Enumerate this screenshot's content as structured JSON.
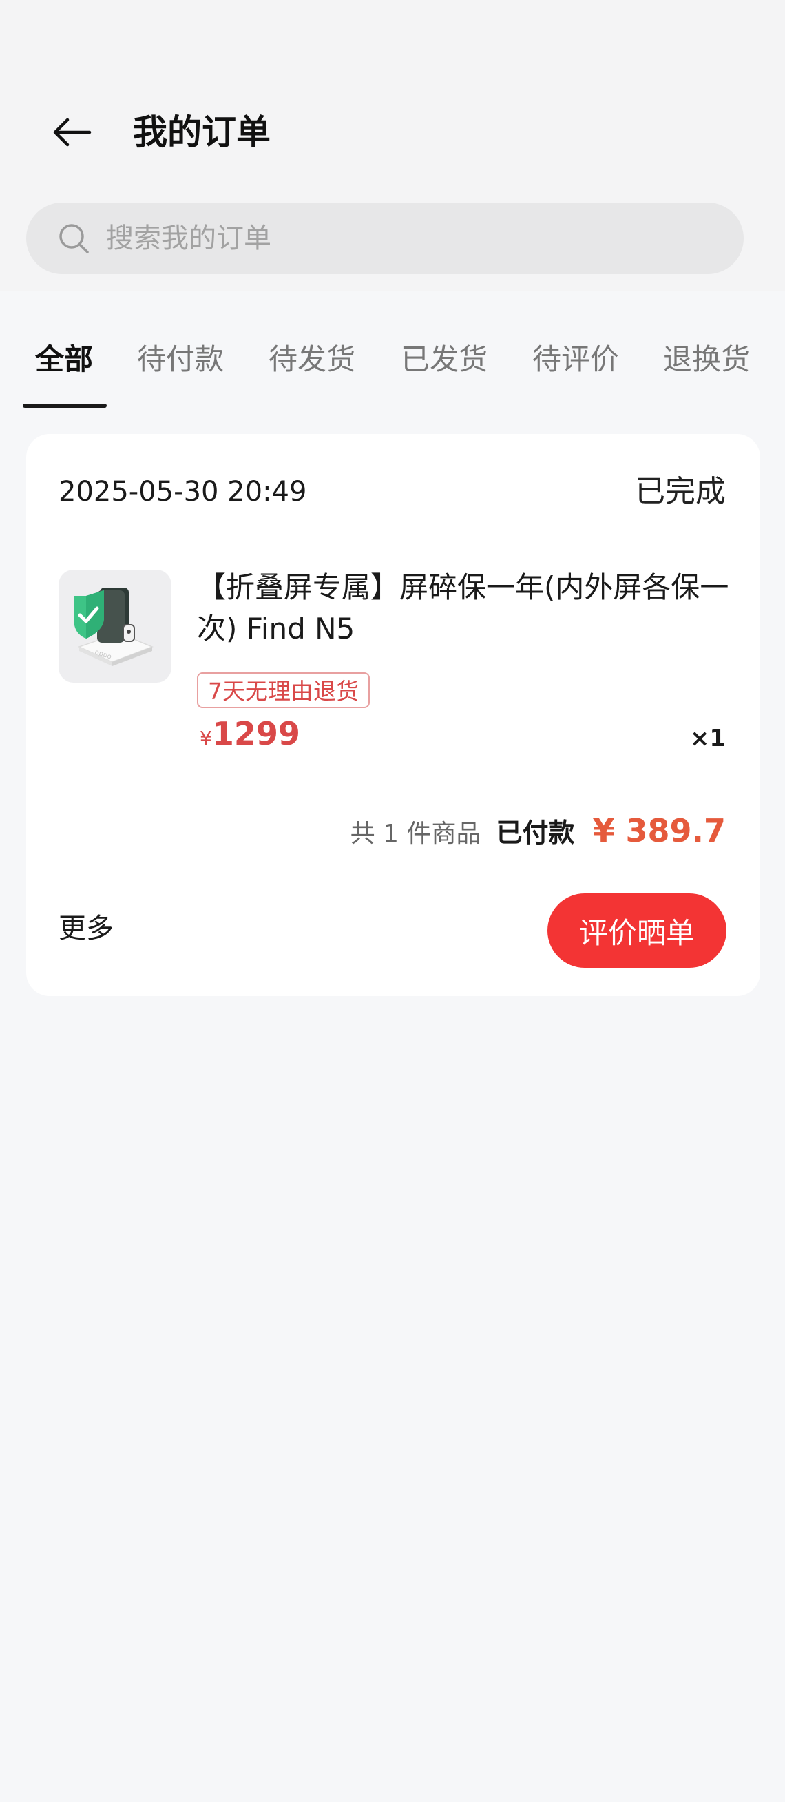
{
  "header": {
    "title": "我的订单",
    "back_icon": "arrow-left-icon"
  },
  "search": {
    "placeholder": "搜索我的订单",
    "icon": "search-icon"
  },
  "tabs": [
    {
      "label": "全部",
      "active": true
    },
    {
      "label": "待付款",
      "active": false
    },
    {
      "label": "待发货",
      "active": false
    },
    {
      "label": "已发货",
      "active": false
    },
    {
      "label": "待评价",
      "active": false
    },
    {
      "label": "退换货",
      "active": false
    }
  ],
  "order": {
    "time": "2025-05-30 20:49",
    "status": "已完成",
    "product": {
      "title": "【折叠屏专属】屏碎保一年(内外屏各保一次) Find N5",
      "badge": "7天无理由退货",
      "currency": "¥",
      "price": "1299",
      "quantity": "×1",
      "brand_on_image": "oppo"
    },
    "summary": {
      "count_text": "共 1 件商品",
      "paid_label": "已付款",
      "total": "¥ 389.7"
    },
    "more_label": "更多",
    "action_label": "评价晒单"
  },
  "colors": {
    "accent_red": "#f33434",
    "price_red": "#d94848",
    "total_orange": "#e55a3c",
    "page_bg": "#f6f7f9"
  }
}
